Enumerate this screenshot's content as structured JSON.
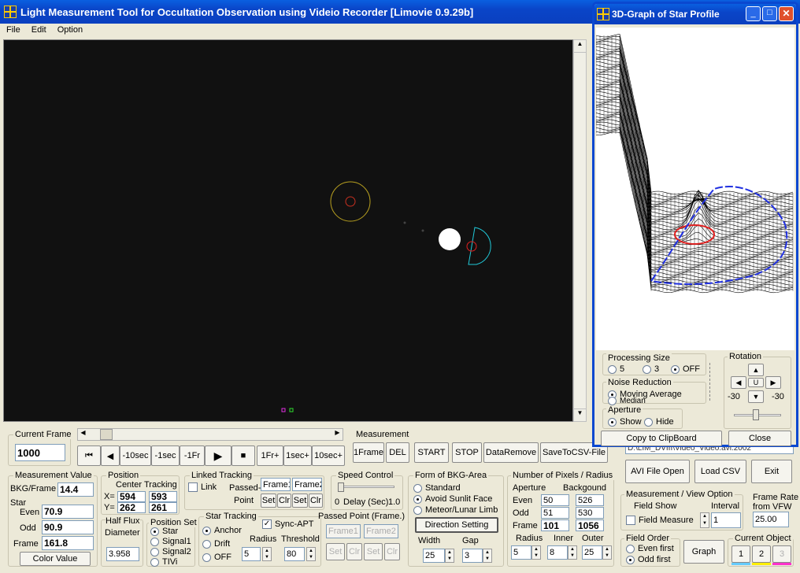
{
  "window": {
    "title": "Light Measurement Tool for Occultation Observation using Videio Recorder [Limovie 0.9.29b]"
  },
  "menu": [
    "File",
    "Edit",
    "Option"
  ],
  "graph_window": {
    "title": "3D-Graph of Star Profile"
  },
  "graph_panel": {
    "processing_size": {
      "label": "Processing Size",
      "options": [
        "5",
        "3",
        "OFF"
      ],
      "selected": "OFF"
    },
    "noise_reduction": {
      "label": "Noise Reduction",
      "options": [
        "Moving Average",
        "Median"
      ],
      "selected": "Moving Average"
    },
    "aperture": {
      "label": "Aperture",
      "options": [
        "Show",
        "Hide"
      ],
      "selected": "Show"
    },
    "rotation": {
      "label": "Rotation",
      "left": "-30",
      "right": "-30",
      "center": "U"
    },
    "copy_label": "Copy to ClipBoard",
    "close_label": "Close"
  },
  "current_frame": {
    "label": "Current Frame",
    "value": "1000"
  },
  "playback": [
    "⏮",
    "◀",
    "-10sec",
    "-1sec",
    "-1Fr",
    "▶",
    "■",
    "1Fr+",
    "1sec+",
    "10sec+"
  ],
  "measurement_bar": {
    "label": "Measurement",
    "buttons": [
      "1Frame",
      "DEL",
      "START",
      "STOP",
      "DataRemove",
      "SaveToCSV-File"
    ]
  },
  "file_path": "D:\\LIM_DVIII\\Video_Video.avi.2002",
  "file_buttons": [
    "AVI File Open",
    "Load CSV",
    "Exit"
  ],
  "measurement_value": {
    "label": "Measurement Value",
    "bkg_label": "BKG/Frame",
    "bkg": "14.4",
    "star_label": "Star",
    "even_label": "Even",
    "even": "70.9",
    "odd_label": "Odd",
    "odd": "90.9",
    "frame_label": "Frame",
    "frame": "161.8",
    "color_btn": "Color Value"
  },
  "position": {
    "label": "Position",
    "center_label": "Center",
    "tracking_label": "Tracking",
    "x_label": "X=",
    "y_label": "Y=",
    "cx": "594",
    "cy": "262",
    "tx": "593",
    "ty": "261"
  },
  "half_flux": {
    "label": "Half Flux",
    "diameter_label": "Diameter",
    "value": "3.958"
  },
  "position_set": {
    "label": "Position Set",
    "options": [
      "Star",
      "Signal1",
      "Signal2",
      "TIVi"
    ],
    "selected": "Star"
  },
  "linked_tracking": {
    "label": "Linked Tracking",
    "link_label": "Link",
    "passed_label": "Passed-",
    "point_label": "Point",
    "frame1": "Frame1",
    "frame2": "Frame2",
    "set": "Set",
    "clr": "Clr"
  },
  "speed_control": {
    "label": "Speed Control",
    "zero": "0",
    "delay_label": "Delay (Sec)",
    "one": "1.0"
  },
  "star_tracking": {
    "label": "Star Tracking",
    "options": [
      "Anchor",
      "Drift",
      "OFF"
    ],
    "selected": "Anchor",
    "sync_label": "Sync-APT",
    "radius_label": "Radius",
    "threshold_label": "Threshold",
    "radius": "5",
    "threshold": "80"
  },
  "passed_point": {
    "label": "Passed Point (Frame.)",
    "frame1": "Frame1",
    "frame2": "Frame2",
    "set": "Set",
    "clr": "Clr"
  },
  "bkg_area": {
    "label": "Form of BKG-Area",
    "options": [
      "Standard",
      "Avoid Sunlit Face",
      "Meteor/Lunar Limb"
    ],
    "selected": "Avoid Sunlit Face",
    "direction_btn": "Direction Setting",
    "width_label": "Width",
    "gap_label": "Gap",
    "width": "25",
    "gap": "3"
  },
  "pixels": {
    "label": "Number of Pixels / Radius",
    "aperture_label": "Aperture",
    "background_label": "Backgound",
    "even_label": "Even",
    "odd_label": "Odd",
    "frame_label": "Frame",
    "even_ap": "50",
    "even_bg": "526",
    "odd_ap": "51",
    "odd_bg": "530",
    "frame_ap": "101",
    "frame_bg": "1056",
    "radius_label": "Radius",
    "inner_label": "Inner",
    "outer_label": "Outer",
    "radius": "5",
    "inner": "8",
    "outer": "25"
  },
  "view_option": {
    "label": "Measurement / View Option",
    "field_show": "Field Show",
    "interval_label": "Interval",
    "field_measure": "Field Measure",
    "interval": "1"
  },
  "frame_rate": {
    "label1": "Frame Rate",
    "label2": "from VFW",
    "value": "25.00"
  },
  "field_order": {
    "label": "Field Order",
    "options": [
      "Even first",
      "Odd first"
    ],
    "selected": "Odd first"
  },
  "graph_btn": "Graph",
  "current_object": {
    "label": "Current Object",
    "items": [
      "1",
      "2",
      "3"
    ],
    "colors": [
      "#66ccff",
      "#ffee00",
      "#ff33cc"
    ]
  }
}
